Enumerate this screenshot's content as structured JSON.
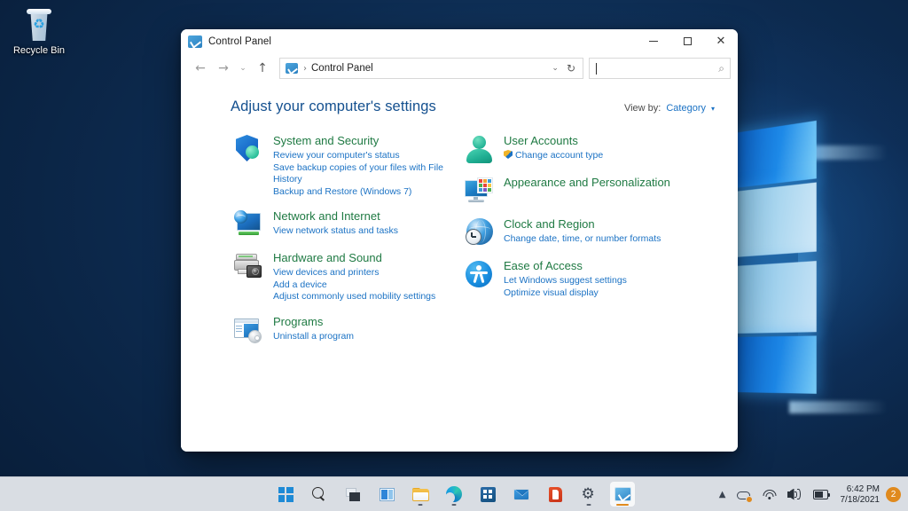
{
  "desktop": {
    "recycle_bin": {
      "label": "Recycle Bin",
      "icon": "recycle-bin-icon"
    }
  },
  "window": {
    "title": "Control Panel",
    "title_icon": "control-panel-icon",
    "controls": {
      "minimize": "–",
      "maximize": "□",
      "close": "✕"
    },
    "nav": {
      "back": "←",
      "forward": "→",
      "recent": "⌄",
      "up": "↑",
      "address_icon": "control-panel-icon",
      "address_separator": "›",
      "breadcrumb": "Control Panel",
      "dropdown": "⌄",
      "refresh": "↻",
      "search_value": "",
      "search_placeholder": "",
      "search_icon": "⌕"
    }
  },
  "content": {
    "page_title": "Adjust your computer's settings",
    "view_by": {
      "label": "View by:",
      "value": "Category",
      "caret": "▾"
    },
    "left_categories": [
      {
        "icon": "shield-security-icon",
        "title": "System and Security",
        "links": [
          {
            "text": "Review your computer's status",
            "has_shield": false
          },
          {
            "text": "Save backup copies of your files with File History",
            "has_shield": false
          },
          {
            "text": "Backup and Restore (Windows 7)",
            "has_shield": false
          }
        ]
      },
      {
        "icon": "network-globe-monitor-icon",
        "title": "Network and Internet",
        "links": [
          {
            "text": "View network status and tasks",
            "has_shield": false
          }
        ]
      },
      {
        "icon": "printer-camera-icon",
        "title": "Hardware and Sound",
        "links": [
          {
            "text": "View devices and printers",
            "has_shield": false
          },
          {
            "text": "Add a device",
            "has_shield": false
          },
          {
            "text": "Adjust commonly used mobility settings",
            "has_shield": false
          }
        ]
      },
      {
        "icon": "programs-disc-icon",
        "title": "Programs",
        "links": [
          {
            "text": "Uninstall a program",
            "has_shield": false
          }
        ]
      }
    ],
    "right_categories": [
      {
        "icon": "user-account-icon",
        "title": "User Accounts",
        "links": [
          {
            "text": "Change account type",
            "has_shield": true
          }
        ]
      },
      {
        "icon": "appearance-monitor-icon",
        "title": "Appearance and Personalization",
        "links": []
      },
      {
        "icon": "clock-globe-icon",
        "title": "Clock and Region",
        "links": [
          {
            "text": "Change date, time, or number formats",
            "has_shield": false
          }
        ]
      },
      {
        "icon": "ease-of-access-icon",
        "title": "Ease of Access",
        "links": [
          {
            "text": "Let Windows suggest settings",
            "has_shield": false
          },
          {
            "text": "Optimize visual display",
            "has_shield": false
          }
        ]
      }
    ]
  },
  "taskbar": {
    "buttons": [
      {
        "name": "start-button",
        "icon": "windows-start-icon",
        "active": false,
        "running": false
      },
      {
        "name": "search-button",
        "icon": "search-icon",
        "active": false,
        "running": false
      },
      {
        "name": "task-view-button",
        "icon": "task-view-icon",
        "active": false,
        "running": false
      },
      {
        "name": "widgets-button",
        "icon": "widgets-icon",
        "active": false,
        "running": false
      },
      {
        "name": "file-explorer-button",
        "icon": "folder-icon",
        "active": false,
        "running": true
      },
      {
        "name": "edge-button",
        "icon": "edge-icon",
        "active": false,
        "running": true
      },
      {
        "name": "microsoft-store-button",
        "icon": "store-icon",
        "active": false,
        "running": false
      },
      {
        "name": "mail-button",
        "icon": "mail-icon",
        "active": false,
        "running": false
      },
      {
        "name": "office-button",
        "icon": "office-icon",
        "active": false,
        "running": false
      },
      {
        "name": "settings-button",
        "icon": "gear-icon",
        "active": false,
        "running": true
      },
      {
        "name": "control-panel-taskbar-button",
        "icon": "control-panel-icon",
        "active": true,
        "running": true
      }
    ],
    "tray": {
      "show_hidden_icon": "chevron-up-icon",
      "onedrive_icon": "onedrive-sync-icon",
      "wifi_icon": "wifi-icon",
      "volume_icon": "volume-icon",
      "battery_icon": "battery-icon",
      "time": "6:42 PM",
      "date": "7/18/2021",
      "notification_count": "2"
    }
  },
  "colors": {
    "category_title": "#1f7a43",
    "link": "#1b72c4",
    "page_title": "#14508f",
    "accent_orange": "#e08a1e",
    "taskbar_bg": "#d9dde3"
  }
}
